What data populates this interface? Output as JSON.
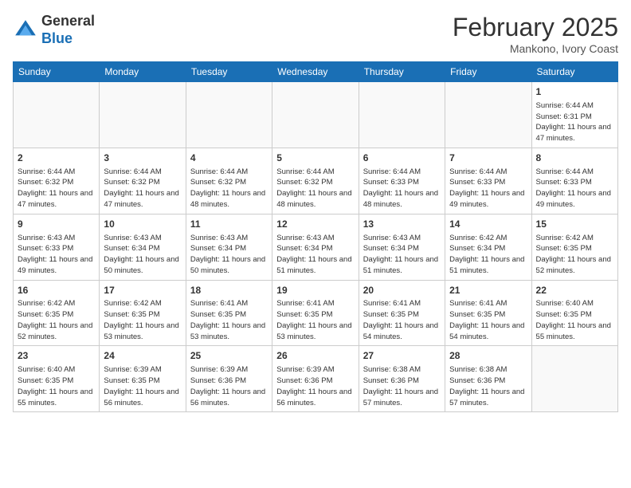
{
  "logo": {
    "general": "General",
    "blue": "Blue"
  },
  "header": {
    "title": "February 2025",
    "subtitle": "Mankono, Ivory Coast"
  },
  "days_of_week": [
    "Sunday",
    "Monday",
    "Tuesday",
    "Wednesday",
    "Thursday",
    "Friday",
    "Saturday"
  ],
  "weeks": [
    [
      {
        "day": "",
        "info": ""
      },
      {
        "day": "",
        "info": ""
      },
      {
        "day": "",
        "info": ""
      },
      {
        "day": "",
        "info": ""
      },
      {
        "day": "",
        "info": ""
      },
      {
        "day": "",
        "info": ""
      },
      {
        "day": "1",
        "info": "Sunrise: 6:44 AM\nSunset: 6:31 PM\nDaylight: 11 hours\nand 47 minutes."
      }
    ],
    [
      {
        "day": "2",
        "info": "Sunrise: 6:44 AM\nSunset: 6:32 PM\nDaylight: 11 hours\nand 47 minutes."
      },
      {
        "day": "3",
        "info": "Sunrise: 6:44 AM\nSunset: 6:32 PM\nDaylight: 11 hours\nand 47 minutes."
      },
      {
        "day": "4",
        "info": "Sunrise: 6:44 AM\nSunset: 6:32 PM\nDaylight: 11 hours\nand 48 minutes."
      },
      {
        "day": "5",
        "info": "Sunrise: 6:44 AM\nSunset: 6:32 PM\nDaylight: 11 hours\nand 48 minutes."
      },
      {
        "day": "6",
        "info": "Sunrise: 6:44 AM\nSunset: 6:33 PM\nDaylight: 11 hours\nand 48 minutes."
      },
      {
        "day": "7",
        "info": "Sunrise: 6:44 AM\nSunset: 6:33 PM\nDaylight: 11 hours\nand 49 minutes."
      },
      {
        "day": "8",
        "info": "Sunrise: 6:44 AM\nSunset: 6:33 PM\nDaylight: 11 hours\nand 49 minutes."
      }
    ],
    [
      {
        "day": "9",
        "info": "Sunrise: 6:43 AM\nSunset: 6:33 PM\nDaylight: 11 hours\nand 49 minutes."
      },
      {
        "day": "10",
        "info": "Sunrise: 6:43 AM\nSunset: 6:34 PM\nDaylight: 11 hours\nand 50 minutes."
      },
      {
        "day": "11",
        "info": "Sunrise: 6:43 AM\nSunset: 6:34 PM\nDaylight: 11 hours\nand 50 minutes."
      },
      {
        "day": "12",
        "info": "Sunrise: 6:43 AM\nSunset: 6:34 PM\nDaylight: 11 hours\nand 51 minutes."
      },
      {
        "day": "13",
        "info": "Sunrise: 6:43 AM\nSunset: 6:34 PM\nDaylight: 11 hours\nand 51 minutes."
      },
      {
        "day": "14",
        "info": "Sunrise: 6:42 AM\nSunset: 6:34 PM\nDaylight: 11 hours\nand 51 minutes."
      },
      {
        "day": "15",
        "info": "Sunrise: 6:42 AM\nSunset: 6:35 PM\nDaylight: 11 hours\nand 52 minutes."
      }
    ],
    [
      {
        "day": "16",
        "info": "Sunrise: 6:42 AM\nSunset: 6:35 PM\nDaylight: 11 hours\nand 52 minutes."
      },
      {
        "day": "17",
        "info": "Sunrise: 6:42 AM\nSunset: 6:35 PM\nDaylight: 11 hours\nand 53 minutes."
      },
      {
        "day": "18",
        "info": "Sunrise: 6:41 AM\nSunset: 6:35 PM\nDaylight: 11 hours\nand 53 minutes."
      },
      {
        "day": "19",
        "info": "Sunrise: 6:41 AM\nSunset: 6:35 PM\nDaylight: 11 hours\nand 53 minutes."
      },
      {
        "day": "20",
        "info": "Sunrise: 6:41 AM\nSunset: 6:35 PM\nDaylight: 11 hours\nand 54 minutes."
      },
      {
        "day": "21",
        "info": "Sunrise: 6:41 AM\nSunset: 6:35 PM\nDaylight: 11 hours\nand 54 minutes."
      },
      {
        "day": "22",
        "info": "Sunrise: 6:40 AM\nSunset: 6:35 PM\nDaylight: 11 hours\nand 55 minutes."
      }
    ],
    [
      {
        "day": "23",
        "info": "Sunrise: 6:40 AM\nSunset: 6:35 PM\nDaylight: 11 hours\nand 55 minutes."
      },
      {
        "day": "24",
        "info": "Sunrise: 6:39 AM\nSunset: 6:35 PM\nDaylight: 11 hours\nand 56 minutes."
      },
      {
        "day": "25",
        "info": "Sunrise: 6:39 AM\nSunset: 6:36 PM\nDaylight: 11 hours\nand 56 minutes."
      },
      {
        "day": "26",
        "info": "Sunrise: 6:39 AM\nSunset: 6:36 PM\nDaylight: 11 hours\nand 56 minutes."
      },
      {
        "day": "27",
        "info": "Sunrise: 6:38 AM\nSunset: 6:36 PM\nDaylight: 11 hours\nand 57 minutes."
      },
      {
        "day": "28",
        "info": "Sunrise: 6:38 AM\nSunset: 6:36 PM\nDaylight: 11 hours\nand 57 minutes."
      },
      {
        "day": "",
        "info": ""
      }
    ]
  ]
}
